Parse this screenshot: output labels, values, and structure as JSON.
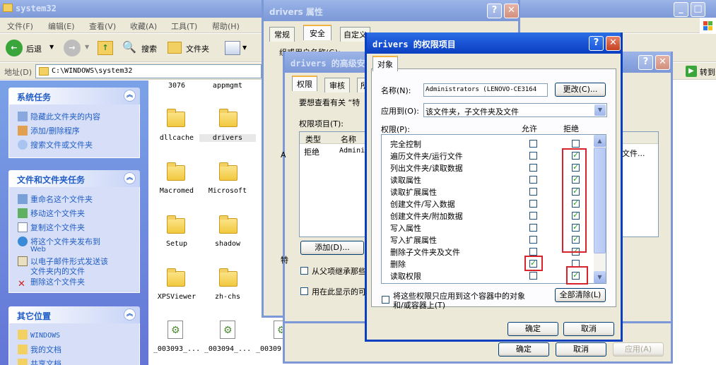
{
  "explorer": {
    "title": "system32",
    "menu": [
      "文件(F)",
      "编辑(E)",
      "查看(V)",
      "收藏(A)",
      "工具(T)",
      "帮助(H)"
    ],
    "toolbar": {
      "back": "后退",
      "search": "搜索",
      "folders": "文件夹"
    },
    "address_label": "地址(D)",
    "address_value": "C:\\WINDOWS\\system32",
    "go_label": "转到",
    "system_tasks": {
      "title": "系统任务",
      "items": [
        "隐藏此文件夹的内容",
        "添加/删除程序",
        "搜索文件或文件夹"
      ]
    },
    "file_tasks": {
      "title": "文件和文件夹任务",
      "items": [
        "重命名这个文件夹",
        "移动这个文件夹",
        "复制这个文件夹",
        "将这个文件夹发布到",
        "Web",
        "以电子邮件形式发送该",
        "文件夹内的文件",
        "删除这个文件夹"
      ]
    },
    "other_places": {
      "title": "其它位置",
      "items": [
        "WINDOWS",
        "我的文档",
        "共享文档"
      ]
    },
    "files": [
      "3076",
      "appmgmt",
      "dllcache",
      "drivers",
      "Macromed",
      "Microsoft",
      "Setup",
      "shadow",
      "XPSViewer",
      "zh-chs",
      "_003093_...",
      "_003094_...",
      "_00309"
    ]
  },
  "props_dialog": {
    "title": "drivers 属性",
    "tabs": [
      "常规",
      "安全",
      "自定义"
    ],
    "group_label": "组或用户名称(G):",
    "ok": "确定",
    "cancel": "取消",
    "apply": "应用(A)"
  },
  "advanced_dialog": {
    "title": "drivers 的高级安",
    "tabs": [
      "权限",
      "审核",
      "所"
    ],
    "intro": "要想查看有关 “特",
    "entries_label": "权限项目(T):",
    "columns": [
      "类型",
      "名称"
    ],
    "row": {
      "type": "拒绝",
      "name": "Admini"
    },
    "right_cell": "文件...",
    "add_button": "添加(D)...",
    "left_marker": "A",
    "inherit_label": "从父项继承那些",
    "child_label": "用在此显示的可",
    "left_marker2": "特"
  },
  "perm_entry": {
    "title": "drivers 的权限项目",
    "tab": "对象",
    "name_label": "名称(N):",
    "name_value": "Administrators (LENOVO-CE3164",
    "change_button": "更改(C)...",
    "apply_to_label": "应用到(O):",
    "apply_to_value": "该文件夹，子文件夹及文件",
    "perms_label": "权限(P):",
    "allow_header": "允许",
    "deny_header": "拒绝",
    "permissions": [
      {
        "name": "完全控制",
        "allow": false,
        "deny": false
      },
      {
        "name": "遍历文件夹/运行文件",
        "allow": false,
        "deny": true
      },
      {
        "name": "列出文件夹/读取数据",
        "allow": false,
        "deny": true
      },
      {
        "name": "读取属性",
        "allow": false,
        "deny": true
      },
      {
        "name": "读取扩展属性",
        "allow": false,
        "deny": true
      },
      {
        "name": "创建文件/写入数据",
        "allow": false,
        "deny": true
      },
      {
        "name": "创建文件夹/附加数据",
        "allow": false,
        "deny": true
      },
      {
        "name": "写入属性",
        "allow": false,
        "deny": true
      },
      {
        "name": "写入扩展属性",
        "allow": false,
        "deny": true
      },
      {
        "name": "删除子文件夹及文件",
        "allow": false,
        "deny": true
      },
      {
        "name": "删除",
        "allow": true,
        "deny": false
      },
      {
        "name": "读取权限",
        "allow": false,
        "deny": true
      }
    ],
    "apply_only_label_1": "将这些权限只应用到这个容器中的对象",
    "apply_only_label_2": "和/或容器上(T)",
    "clear_all_button": "全部清除(L)",
    "ok": "确定",
    "cancel": "取消"
  },
  "colors": {
    "xp_blue": "#0a3fbf",
    "deny_highlight": "#d9232a",
    "task_link": "#215dc6"
  }
}
